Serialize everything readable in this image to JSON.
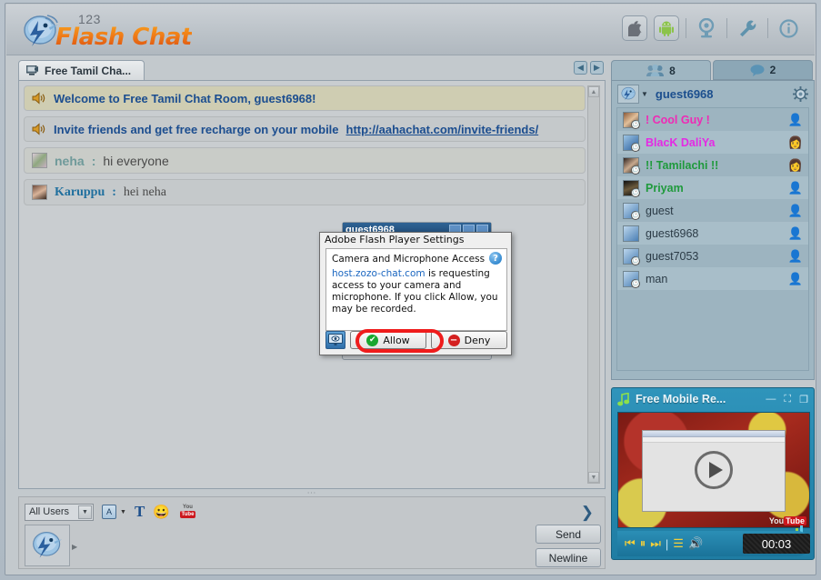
{
  "header": {
    "logo_sup": "123",
    "logo_text": "Flash Chat",
    "icons": [
      {
        "name": "apple-icon",
        "glyph": ""
      },
      {
        "name": "android-icon",
        "glyph": "⚙"
      },
      {
        "name": "webcam-icon",
        "glyph": "●"
      },
      {
        "name": "wrench-icon",
        "glyph": "⚒"
      },
      {
        "name": "info-icon",
        "glyph": "i"
      }
    ]
  },
  "chat": {
    "tab_label": "Free Tamil Cha...",
    "nav_prev": "◀",
    "nav_next": "▶",
    "messages": [
      {
        "type": "system",
        "text": "Welcome to Free Tamil Chat Room, guest6968!",
        "style": "sys"
      },
      {
        "type": "system",
        "text": "Invite friends and get free recharge on your mobile ",
        "link": "http://aahachat.com/invite-friends/",
        "style": "plain"
      },
      {
        "type": "user",
        "user": "neha",
        "color": "#6f9a9a",
        "text": "hi everyone",
        "style": "alt"
      },
      {
        "type": "user",
        "user": "Karuppu",
        "color": "#1f6f9e",
        "text": "hei neha",
        "style": "plain"
      }
    ]
  },
  "toolbar": {
    "audience": "All Users",
    "font_label": "A",
    "text_style_label": "T",
    "emoji": "😀",
    "youtube_top": "You",
    "youtube_bottom": "Tube",
    "expand": "❯",
    "send_label": "Send",
    "newline_label": "Newline",
    "input_value": "",
    "input_placeholder": ""
  },
  "right_panel": {
    "tab_users_count": "8",
    "tab_chat_count": "2",
    "me_name": "guest6968",
    "users": [
      {
        "name": "! Cool Guy !",
        "color": "#ef2ab5",
        "gender": "male"
      },
      {
        "name": "BlacK DaliYa",
        "color": "#e42ae4",
        "gender": "female"
      },
      {
        "name": "!! Tamilachi !!",
        "color": "#1f9a3c",
        "gender": "female"
      },
      {
        "name": "Priyam",
        "color": "#1f9a3c",
        "gender": "male"
      },
      {
        "name": "guest",
        "color": "#2b3b46",
        "gender": "unknown"
      },
      {
        "name": "guest6968",
        "color": "#2b3b46",
        "gender": "unknown"
      },
      {
        "name": "guest7053",
        "color": "#2b3b46",
        "gender": "unknown"
      },
      {
        "name": "man",
        "color": "#2b3b46",
        "gender": "male"
      }
    ]
  },
  "video": {
    "title": "Free Mobile Re...",
    "time": "00:03",
    "minimize": "—",
    "fullscreen": "⛶",
    "restore": "❐",
    "prev": "⏮",
    "pause": "⏸",
    "next": "⏭",
    "playlist": "☰",
    "volume": "🔊",
    "watermark_you": "You",
    "watermark_tube": "Tube"
  },
  "behind_window": {
    "title": "guest6968"
  },
  "flash_dialog": {
    "title": "Adobe Flash Player Settings",
    "heading": "Camera and Microphone Access",
    "help": "?",
    "domain": "host.zozo-chat.com",
    "body_text": " is requesting access to your camera and microphone. If you click Allow, you may be recorded.",
    "allow_label": "Allow",
    "deny_label": "Deny",
    "allow_icon": "✔",
    "deny_icon": "−"
  }
}
